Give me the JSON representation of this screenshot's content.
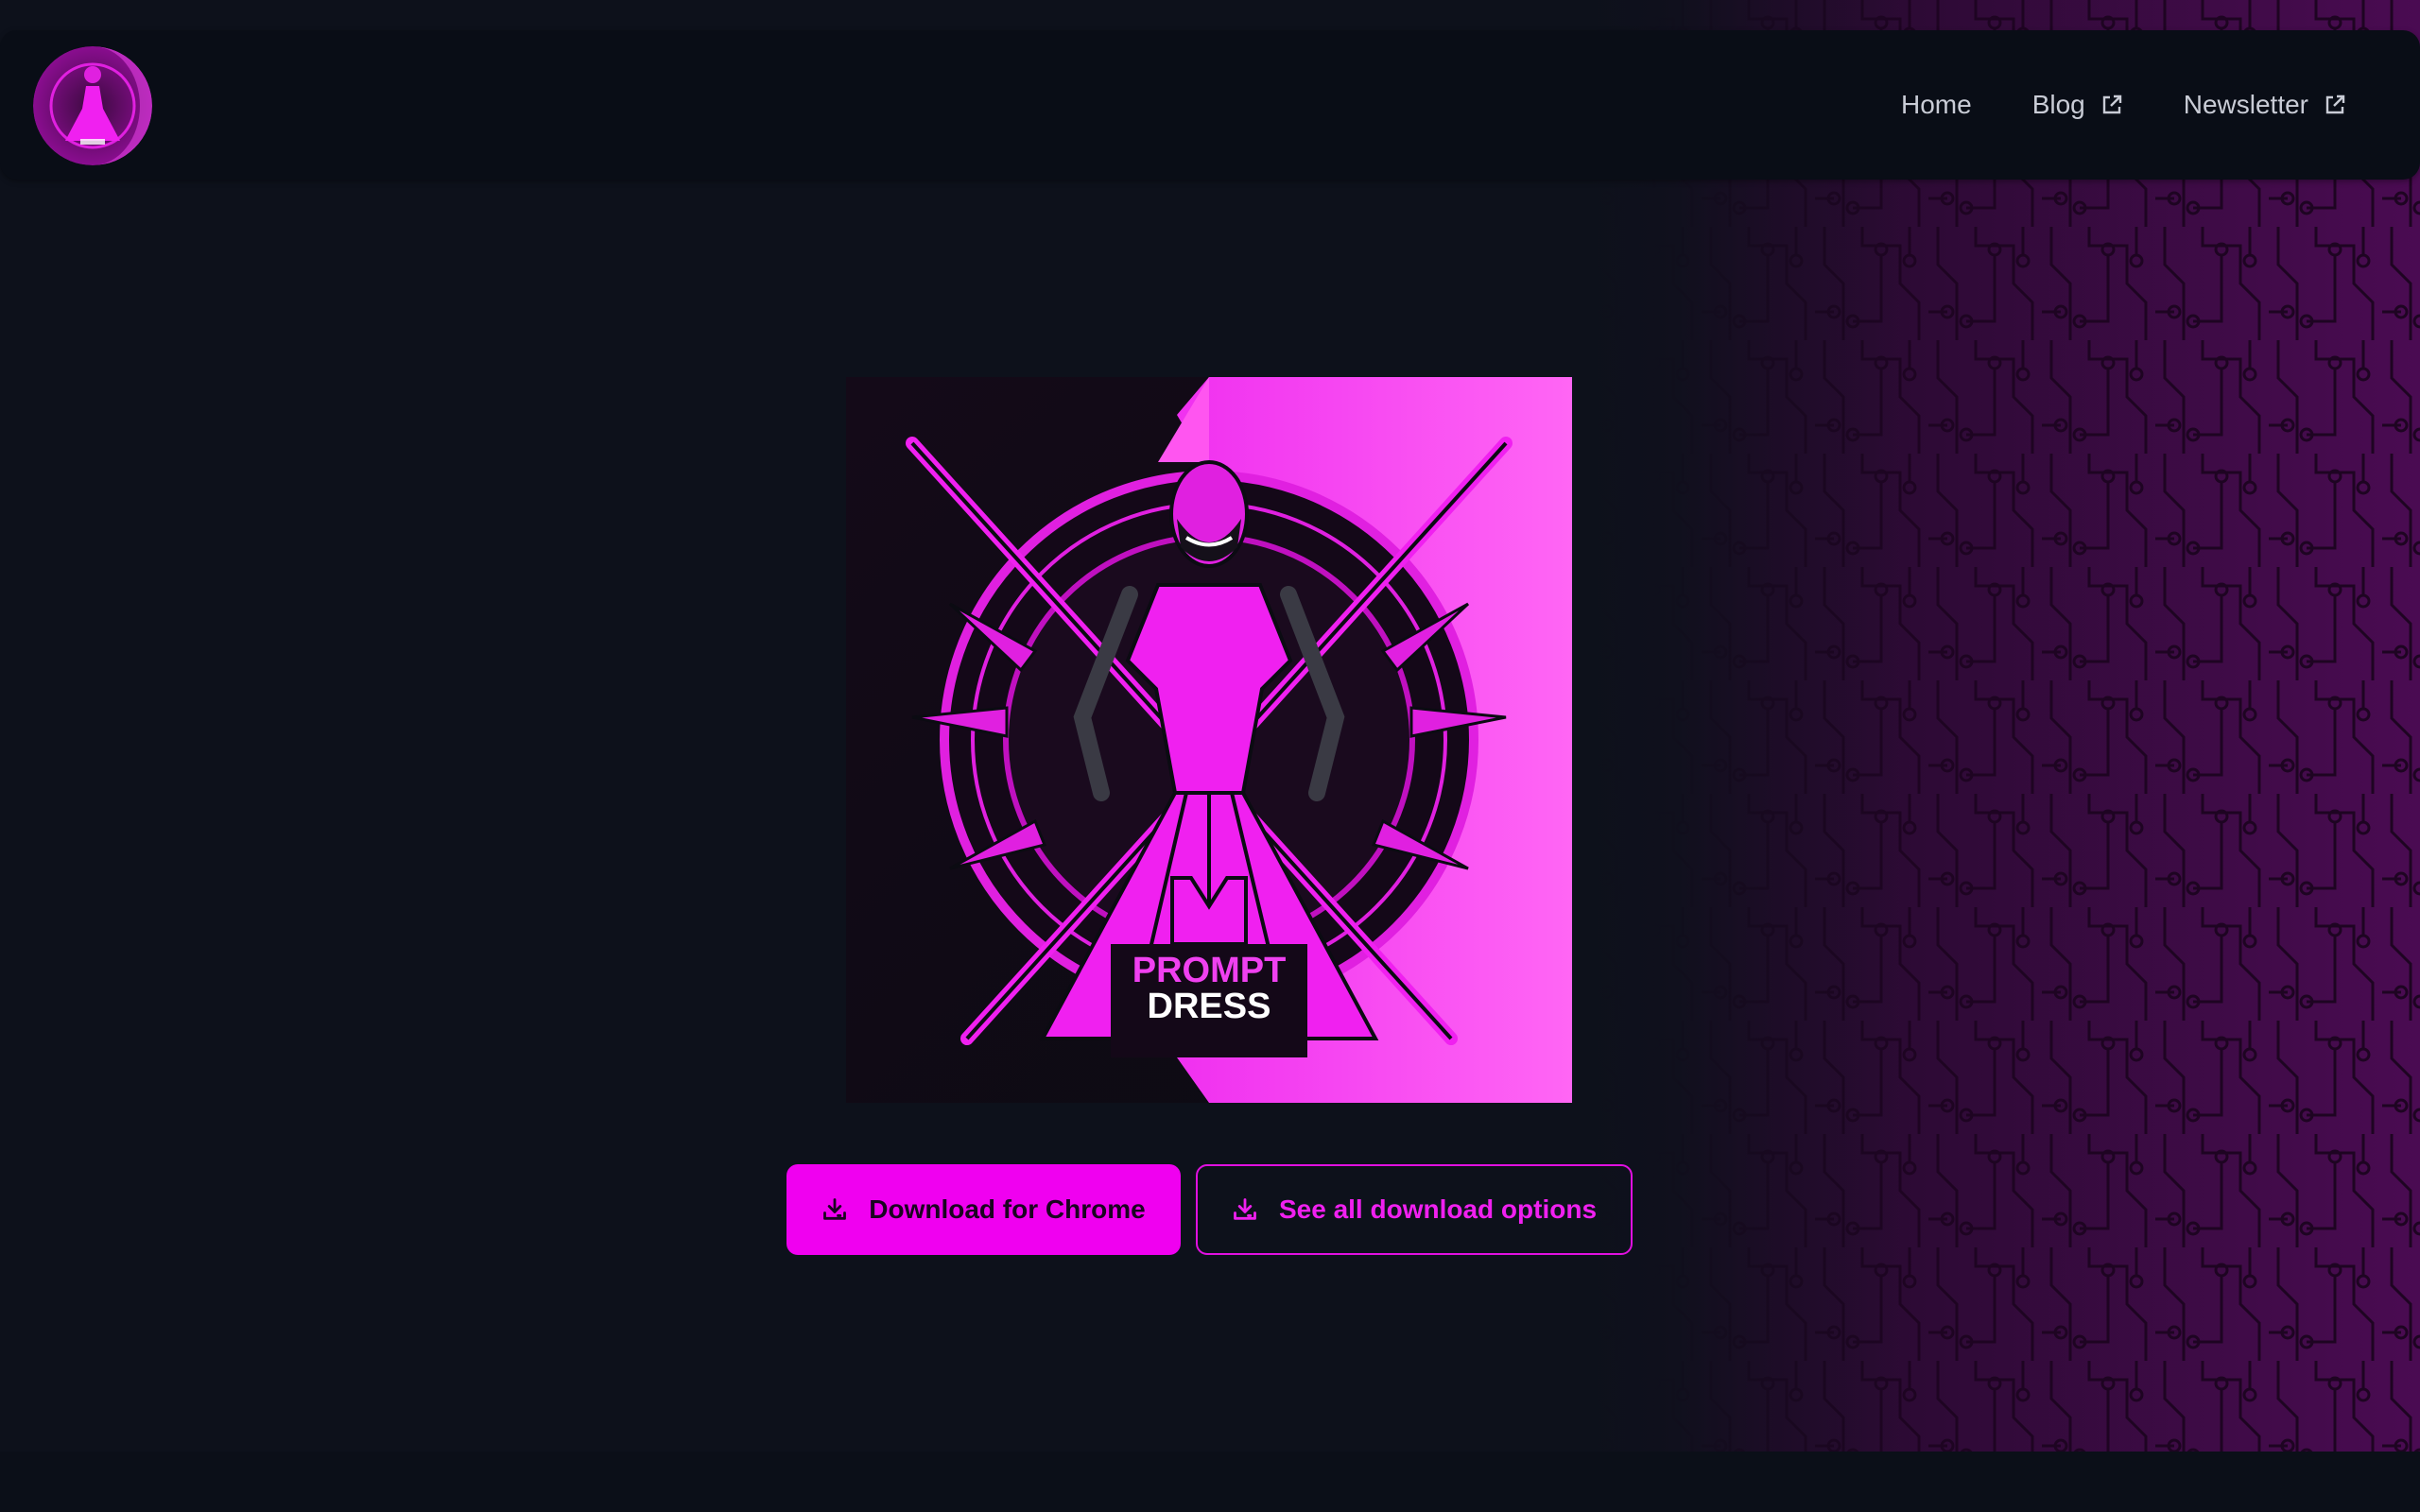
{
  "nav": {
    "items": [
      {
        "label": "Home",
        "external": false
      },
      {
        "label": "Blog",
        "external": true
      },
      {
        "label": "Newsletter",
        "external": true
      }
    ]
  },
  "hero": {
    "logo_text_line1": "PROMPT",
    "logo_text_line2": "DRESS"
  },
  "buttons": {
    "primary_label": "Download for Chrome",
    "secondary_label": "See all download options",
    "icon": "download-tray-icon"
  },
  "colors": {
    "accent": "#f000f0",
    "background": "#0d111b",
    "header_bg": "#090d16",
    "circuit": "#6b0d6e"
  }
}
